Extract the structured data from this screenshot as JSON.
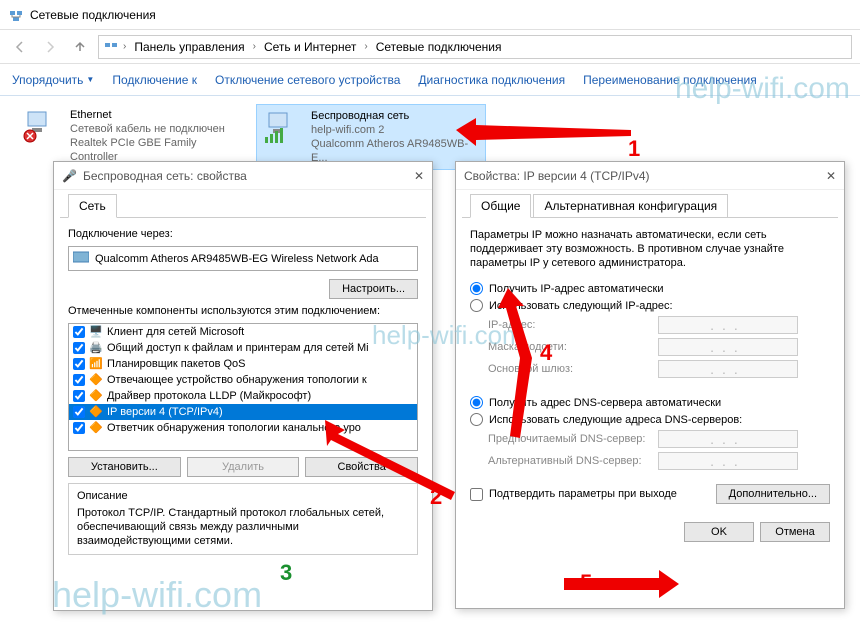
{
  "window": {
    "title": "Сетевые подключения"
  },
  "breadcrumb": {
    "b1": "Панель управления",
    "b2": "Сеть и Интернет",
    "b3": "Сетевые подключения"
  },
  "toolbar": {
    "organize": "Упорядочить",
    "connect": "Подключение к",
    "disable": "Отключение сетевого устройства",
    "diagnose": "Диагностика подключения",
    "rename": "Переименование подключения"
  },
  "connections": {
    "eth": {
      "name": "Ethernet",
      "status": "Сетевой кабель не подключен",
      "adapter": "Realtek PCIe GBE Family Controller"
    },
    "wifi": {
      "name": "Беспроводная сеть",
      "status": "help-wifi.com  2",
      "adapter": "Qualcomm Atheros AR9485WB-E..."
    }
  },
  "dlg1": {
    "title": "Беспроводная сеть: свойства",
    "tab": "Сеть",
    "conn_via": "Подключение через:",
    "adapter": "Qualcomm Atheros AR9485WB-EG Wireless Network Ada",
    "configure": "Настроить...",
    "components_label": "Отмеченные компоненты используются этим подключением:",
    "items": [
      "Клиент для сетей Microsoft",
      "Общий доступ к файлам и принтерам для сетей Mi",
      "Планировщик пакетов QoS",
      "Отвечающее устройство обнаружения топологии к",
      "Драйвер протокола LLDP (Майкрософт)",
      "IP версии 4 (TCP/IPv4)",
      "Ответчик обнаружения топологии канального уро"
    ],
    "install": "Установить...",
    "remove": "Удалить",
    "props": "Свойства",
    "desc_label": "Описание",
    "desc": "Протокол TCP/IP. Стандартный протокол глобальных сетей, обеспечивающий связь между различными взаимодействующими сетями."
  },
  "dlg2": {
    "title": "Свойства: IP версии 4 (TCP/IPv4)",
    "tab1": "Общие",
    "tab2": "Альтернативная конфигурация",
    "intro": "Параметры IP можно назначать автоматически, если сеть поддерживает эту возможность. В противном случае узнайте параметры IP у сетевого администратора.",
    "r1": "Получить IP-адрес автоматически",
    "r2": "Использовать следующий IP-адрес:",
    "f1": "IP-адрес:",
    "f2": "Маска подсети:",
    "f3": "Основной шлюз:",
    "r3": "Получить адрес DNS-сервера автоматически",
    "r4": "Использовать следующие адреса DNS-серверов:",
    "f4": "Предпочитаемый DNS-сервер:",
    "f5": "Альтернативный DNS-сервер:",
    "confirm": "Подтвердить параметры при выходе",
    "advanced": "Дополнительно...",
    "ok": "OK",
    "cancel": "Отмена"
  },
  "watermark": "help-wifi.com",
  "annotations": {
    "n1": "1",
    "n2": "2",
    "n3": "3",
    "n4": "4",
    "n5": "5"
  }
}
